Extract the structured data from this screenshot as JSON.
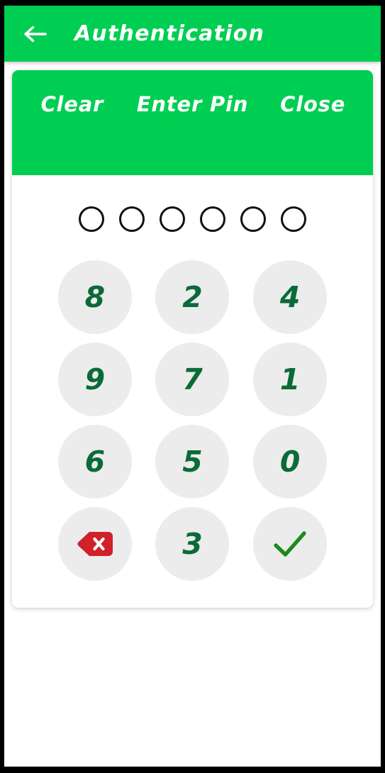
{
  "appbar": {
    "back_icon": "arrow-left-icon",
    "title": "Authentication"
  },
  "pin_card": {
    "header": {
      "clear_label": "Clear",
      "title_label": "Enter Pin",
      "close_label": "Close"
    },
    "pin_display": {
      "length": 6,
      "filled_count": 0,
      "dots": [
        "",
        "",
        "",
        "",
        "",
        ""
      ]
    },
    "keypad": {
      "rows": [
        [
          {
            "type": "digit",
            "label": "8",
            "name": "key-8"
          },
          {
            "type": "digit",
            "label": "2",
            "name": "key-2"
          },
          {
            "type": "digit",
            "label": "4",
            "name": "key-4"
          }
        ],
        [
          {
            "type": "digit",
            "label": "9",
            "name": "key-9"
          },
          {
            "type": "digit",
            "label": "7",
            "name": "key-7"
          },
          {
            "type": "digit",
            "label": "1",
            "name": "key-1"
          }
        ],
        [
          {
            "type": "digit",
            "label": "6",
            "name": "key-6"
          },
          {
            "type": "digit",
            "label": "5",
            "name": "key-5"
          },
          {
            "type": "digit",
            "label": "0",
            "name": "key-0"
          }
        ],
        [
          {
            "type": "backspace",
            "label": "",
            "name": "key-backspace",
            "icon": "backspace-delete-icon"
          },
          {
            "type": "digit",
            "label": "3",
            "name": "key-3"
          },
          {
            "type": "confirm",
            "label": "",
            "name": "key-confirm",
            "icon": "check-mark-icon"
          }
        ]
      ]
    }
  },
  "colors": {
    "brand_green": "#00CE53",
    "digit_green": "#0B6B38",
    "check_green": "#1B8A1B",
    "backspace_red": "#D0212B",
    "key_background": "#ECECEC",
    "card_background": "#FFFFFF",
    "frame_black": "#000000",
    "dot_outline": "#111111"
  }
}
